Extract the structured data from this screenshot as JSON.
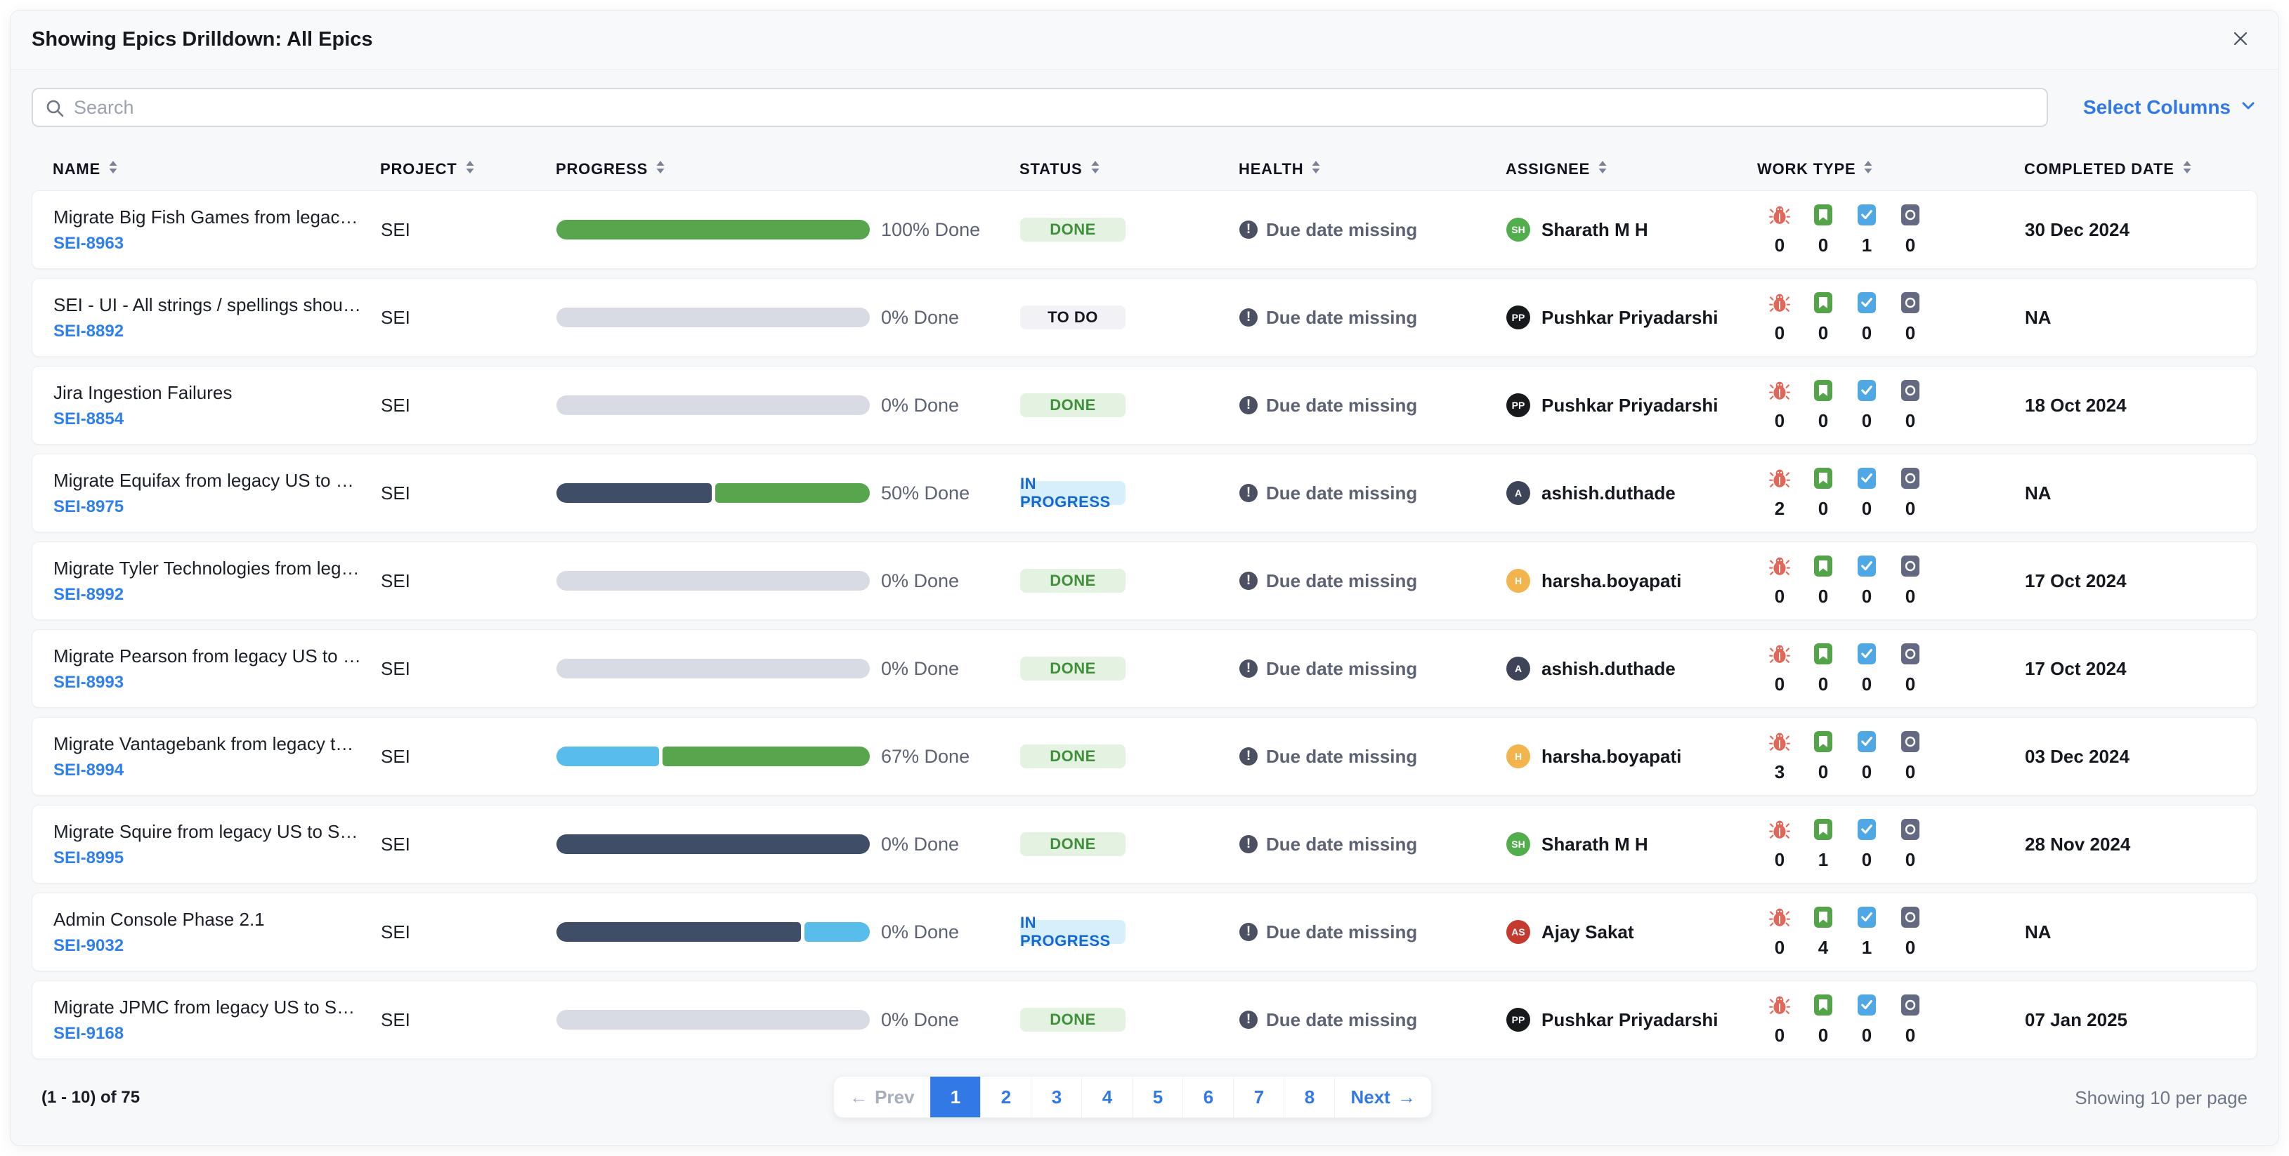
{
  "modal": {
    "title": "Showing Epics Drilldown: All Epics"
  },
  "toolbar": {
    "search_placeholder": "Search",
    "select_columns_label": "Select Columns"
  },
  "columns": [
    "Name",
    "Project",
    "Progress",
    "Status",
    "Health",
    "Assignee",
    "Work Type",
    "Completed Date"
  ],
  "colors": {
    "accent_blue": "#3379e6",
    "link_blue": "#2f80ed",
    "bar_colors": {
      "green": "#57a64e",
      "gray": "#d9dbe4",
      "dark": "#404d66",
      "blue": "#58bdea"
    },
    "status": {
      "done": {
        "bg": "#e4f3e1",
        "text": "#3f8f3b"
      },
      "todo": {
        "bg": "#f1f1f6",
        "text": "#17191f"
      },
      "inprogress": {
        "bg": "#d7effb",
        "text": "#1668d1"
      }
    },
    "work_type_icons": {
      "bug": "#e0685b",
      "story": "#53a348",
      "task": "#4fa7e4",
      "other": "#636981"
    }
  },
  "work_type_order": [
    "bug-icon",
    "story-icon",
    "task-icon",
    "issue-circle-icon"
  ],
  "rows": [
    {
      "name": "Migrate Big Fish Games from legacy US to SEI ...",
      "id": "SEI-8963",
      "project": "SEI",
      "progress": {
        "label": "100% Done",
        "segments": [
          [
            "green",
            100
          ]
        ]
      },
      "status": {
        "label": "DONE",
        "type": "done"
      },
      "health": "Due date missing",
      "assignee": {
        "initials": "SH",
        "color": "#52ae4d",
        "name": "Sharath M H"
      },
      "work_counts": [
        0,
        0,
        1,
        0
      ],
      "completed": "30 Dec 2024"
    },
    {
      "name": "SEI - UI - All strings / spellings should be in A...",
      "id": "SEI-8892",
      "project": "SEI",
      "progress": {
        "label": "0% Done",
        "segments": [
          [
            "gray",
            100
          ]
        ]
      },
      "status": {
        "label": "TO DO",
        "type": "todo"
      },
      "health": "Due date missing",
      "assignee": {
        "initials": "PP",
        "color": "#17191d",
        "name": "Pushkar Priyadarshi"
      },
      "work_counts": [
        0,
        0,
        0,
        0
      ],
      "completed": "NA"
    },
    {
      "name": "Jira Ingestion Failures",
      "id": "SEI-8854",
      "project": "SEI",
      "progress": {
        "label": "0% Done",
        "segments": [
          [
            "gray",
            100
          ]
        ]
      },
      "status": {
        "label": "DONE",
        "type": "done"
      },
      "health": "Due date missing",
      "assignee": {
        "initials": "PP",
        "color": "#17191d",
        "name": "Pushkar Priyadarshi"
      },
      "work_counts": [
        0,
        0,
        0,
        0
      ],
      "completed": "18 Oct 2024"
    },
    {
      "name": "Migrate Equifax from legacy US to SEI on Harn...",
      "id": "SEI-8975",
      "project": "SEI",
      "progress": {
        "label": "50% Done",
        "segments": [
          [
            "dark",
            50
          ],
          [
            "green",
            50
          ]
        ]
      },
      "status": {
        "label": "IN PROGRESS",
        "type": "inprogress"
      },
      "health": "Due date missing",
      "assignee": {
        "initials": "A",
        "color": "#3e4457",
        "name": "ashish.duthade"
      },
      "work_counts": [
        2,
        0,
        0,
        0
      ],
      "completed": "NA"
    },
    {
      "name": "Migrate Tyler Technologies from legacy US to ...",
      "id": "SEI-8992",
      "project": "SEI",
      "progress": {
        "label": "0% Done",
        "segments": [
          [
            "gray",
            100
          ]
        ]
      },
      "status": {
        "label": "DONE",
        "type": "done"
      },
      "health": "Due date missing",
      "assignee": {
        "initials": "H",
        "color": "#f2b44c",
        "name": "harsha.boyapati"
      },
      "work_counts": [
        0,
        0,
        0,
        0
      ],
      "completed": "17 Oct 2024"
    },
    {
      "name": "Migrate Pearson from legacy US to SEI on Har...",
      "id": "SEI-8993",
      "project": "SEI",
      "progress": {
        "label": "0% Done",
        "segments": [
          [
            "gray",
            100
          ]
        ]
      },
      "status": {
        "label": "DONE",
        "type": "done"
      },
      "health": "Due date missing",
      "assignee": {
        "initials": "A",
        "color": "#3e4457",
        "name": "ashish.duthade"
      },
      "work_counts": [
        0,
        0,
        0,
        0
      ],
      "completed": "17 Oct 2024"
    },
    {
      "name": "Migrate Vantagebank from legacy to SEI on Ha...",
      "id": "SEI-8994",
      "project": "SEI",
      "progress": {
        "label": "67% Done",
        "segments": [
          [
            "blue",
            33
          ],
          [
            "green",
            67
          ]
        ]
      },
      "status": {
        "label": "DONE",
        "type": "done"
      },
      "health": "Due date missing",
      "assignee": {
        "initials": "H",
        "color": "#f2b44c",
        "name": "harsha.boyapati"
      },
      "work_counts": [
        3,
        0,
        0,
        0
      ],
      "completed": "03 Dec 2024"
    },
    {
      "name": "Migrate Squire from legacy US to SEI on Harne...",
      "id": "SEI-8995",
      "project": "SEI",
      "progress": {
        "label": "0% Done",
        "segments": [
          [
            "dark",
            100
          ]
        ]
      },
      "status": {
        "label": "DONE",
        "type": "done"
      },
      "health": "Due date missing",
      "assignee": {
        "initials": "SH",
        "color": "#52ae4d",
        "name": "Sharath M H"
      },
      "work_counts": [
        0,
        1,
        0,
        0
      ],
      "completed": "28 Nov 2024"
    },
    {
      "name": "Admin Console Phase 2.1",
      "id": "SEI-9032",
      "project": "SEI",
      "progress": {
        "label": "0% Done",
        "segments": [
          [
            "dark",
            79
          ],
          [
            "blue",
            21
          ]
        ]
      },
      "status": {
        "label": "IN PROGRESS",
        "type": "inprogress"
      },
      "health": "Due date missing",
      "assignee": {
        "initials": "AS",
        "color": "#c43a2f",
        "name": "Ajay Sakat"
      },
      "work_counts": [
        0,
        4,
        1,
        0
      ],
      "completed": "NA"
    },
    {
      "name": "Migrate JPMC from legacy US to SEI on Harne...",
      "id": "SEI-9168",
      "project": "SEI",
      "progress": {
        "label": "0% Done",
        "segments": [
          [
            "gray",
            100
          ]
        ]
      },
      "status": {
        "label": "DONE",
        "type": "done"
      },
      "health": "Due date missing",
      "assignee": {
        "initials": "PP",
        "color": "#17191d",
        "name": "Pushkar Priyadarshi"
      },
      "work_counts": [
        0,
        0,
        0,
        0
      ],
      "completed": "07 Jan 2025"
    }
  ],
  "footer": {
    "range_label": "(1 - 10) of 75",
    "prev_label": "Prev",
    "prev_arrow": "←",
    "next_label": "Next",
    "next_arrow": "→",
    "pages": [
      "1",
      "2",
      "3",
      "4",
      "5",
      "6",
      "7",
      "8"
    ],
    "active_page": "1",
    "per_page_label": "Showing 10 per page"
  }
}
